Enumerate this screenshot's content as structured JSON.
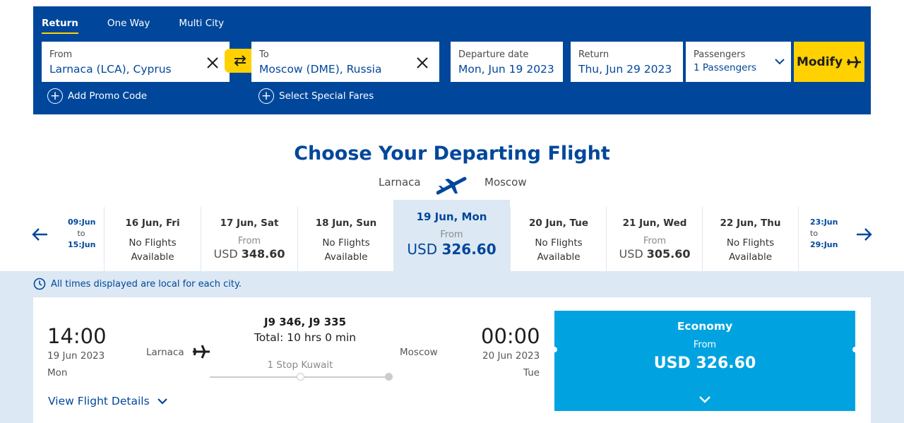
{
  "trip_tabs": [
    "Return",
    "One Way",
    "Multi City"
  ],
  "from_field": {
    "label": "From",
    "value": "Larnaca (LCA), Cyprus"
  },
  "to_field": {
    "label": "To",
    "value": "Moscow (DME), Russia"
  },
  "departure_field": {
    "label": "Departure date",
    "value": "Mon, Jun 19 2023"
  },
  "return_field": {
    "label": "Return",
    "value": "Thu, Jun 29 2023"
  },
  "passengers_field": {
    "label": "Passengers",
    "value": "1 Passengers"
  },
  "modify_label": "Modify",
  "promo_label": "Add Promo Code",
  "special_fares_label": "Select Special Fares",
  "heading": "Choose Your Departing Flight",
  "route": {
    "origin": "Larnaca",
    "destination": "Moscow"
  },
  "prev_range": {
    "start": "09:Jun",
    "to": "to",
    "end": "15:Jun"
  },
  "next_range": {
    "start": "23:Jun",
    "to": "to",
    "end": "29:Jun"
  },
  "dates": [
    {
      "day": "16 Jun, Fri",
      "no_flights": "No Flights",
      "available": "Available"
    },
    {
      "day": "17 Jun, Sat",
      "from": "From",
      "currency": "USD",
      "amount": "348.60"
    },
    {
      "day": "18 Jun, Sun",
      "no_flights": "No Flights",
      "available": "Available"
    },
    {
      "day": "19 Jun, Mon",
      "from": "From",
      "currency": "USD",
      "amount": "326.60"
    },
    {
      "day": "20 Jun, Tue",
      "no_flights": "No Flights",
      "available": "Available"
    },
    {
      "day": "21 Jun, Wed",
      "from": "From",
      "currency": "USD",
      "amount": "305.60"
    },
    {
      "day": "22 Jun, Thu",
      "no_flights": "No Flights",
      "available": "Available"
    }
  ],
  "timezone_note": "All times displayed are local for each city.",
  "flight": {
    "depart_time": "14:00",
    "depart_date": "19 Jun 2023",
    "depart_day": "Mon",
    "origin": "Larnaca",
    "flight_numbers": "J9 346, J9 335",
    "total": "Total: 10 hrs 0 min",
    "stops": "1 Stop Kuwait",
    "destination": "Moscow",
    "arrive_time": "00:00",
    "arrive_date": "20 Jun 2023",
    "arrive_day": "Tue",
    "view_details": "View Flight Details",
    "fare_class": "Economy",
    "fare_from": "From",
    "fare_price": "USD 326.60"
  },
  "colors": {
    "brand_blue": "#00479b",
    "accent_yellow": "#ffd100",
    "fare_blue": "#00a3e0",
    "band_blue": "#dce8f3"
  },
  "icons": [
    "close-icon",
    "swap-icon",
    "chevron-down-icon",
    "plane-icon",
    "plus-icon",
    "arrow-left-icon",
    "arrow-right-icon",
    "clock-icon"
  ]
}
